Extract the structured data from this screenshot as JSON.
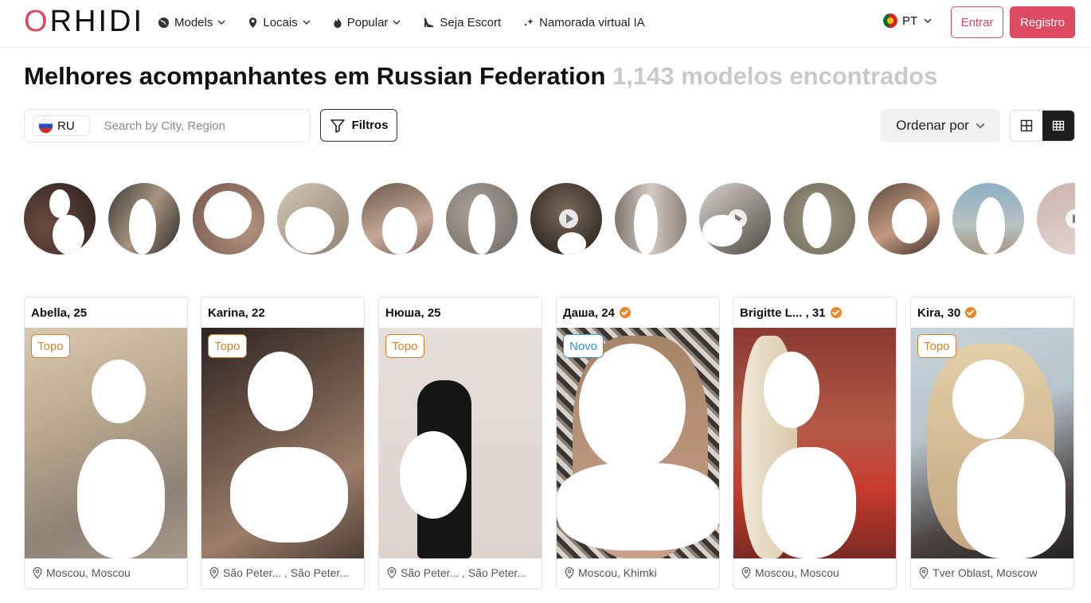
{
  "header": {
    "logo_first": "O",
    "logo_rest": "RHIDI",
    "nav": [
      {
        "label": "Models",
        "icon": "globe-icon",
        "dropdown": true
      },
      {
        "label": "Locais",
        "icon": "map-pin-icon",
        "dropdown": true
      },
      {
        "label": "Popular",
        "icon": "flame-icon",
        "dropdown": true
      },
      {
        "label": "Seja Escort",
        "icon": "heel-icon",
        "dropdown": false
      },
      {
        "label": "Namorada virtual IA",
        "icon": "sparkle-icon",
        "dropdown": false
      }
    ],
    "language": "PT",
    "login_label": "Entrar",
    "register_label": "Registro"
  },
  "title": {
    "main": "Melhores acompanhantes em Russian Federation",
    "count": "1,143 modelos encontrados"
  },
  "search": {
    "country_code": "RU",
    "placeholder": "Search by City, Region",
    "filters_label": "Filtros",
    "sort_label": "Ordenar por"
  },
  "colors": {
    "brand": "#dc4b61",
    "topo_badge": "#d9822b",
    "novo_badge": "#3a8ed0",
    "verified": "#e9872a"
  },
  "cards": [
    {
      "name": "Abella, 25",
      "verified": false,
      "badge": "Topo",
      "location": "Moscou, Moscou"
    },
    {
      "name": "Karina, 22",
      "verified": false,
      "badge": "Topo",
      "location": "São Peter... , São Peter..."
    },
    {
      "name": "Нюша, 25",
      "verified": false,
      "badge": "Topo",
      "location": "São Peter... , São Peter..."
    },
    {
      "name": "Даша, 24",
      "verified": true,
      "badge": "Novo",
      "location": "Moscou, Khimki"
    },
    {
      "name": "Brigitte L...  , 31",
      "verified": true,
      "badge": "",
      "location": "Moscou, Moscou"
    },
    {
      "name": "Kira, 30",
      "verified": true,
      "badge": "Topo",
      "location": "Tver Oblast, Moscow"
    }
  ]
}
